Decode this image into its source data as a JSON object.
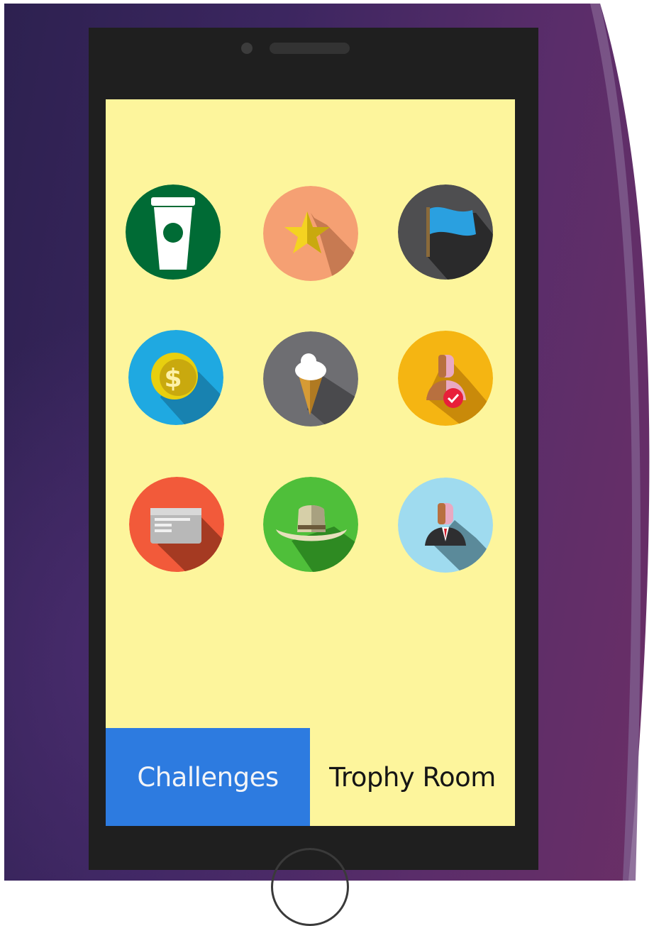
{
  "tabs": [
    {
      "label": "Challenges",
      "active": true
    },
    {
      "label": "Trophy Room",
      "active": false
    }
  ],
  "badges": [
    {
      "icon": "coffee-cup-icon",
      "color": "#006b35"
    },
    {
      "icon": "star-icon",
      "color": "#f5a073"
    },
    {
      "icon": "flag-icon",
      "color": "#4e4e50"
    },
    {
      "icon": "dollar-coin-icon",
      "color": "#1fa9e1"
    },
    {
      "icon": "ice-cream-icon",
      "color": "#6e6e72"
    },
    {
      "icon": "user-check-icon",
      "color": "#f5b512"
    },
    {
      "icon": "credit-card-icon",
      "color": "#f25a3a"
    },
    {
      "icon": "cowboy-hat-icon",
      "color": "#4fbf3a"
    },
    {
      "icon": "businessman-icon",
      "color": "#9fdbef"
    }
  ],
  "colors": {
    "screen_background": "#fdf59c",
    "active_tab": "#2d7be0",
    "phone_body": "#1f1f1f"
  }
}
